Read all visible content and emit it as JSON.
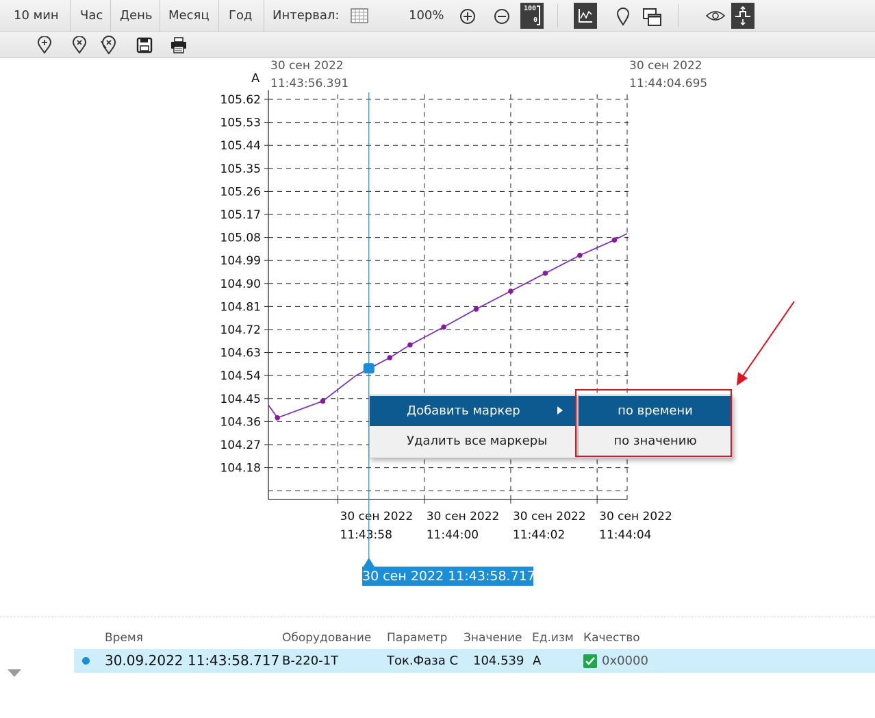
{
  "toolbar": {
    "ranges": [
      "10 мин",
      "Час",
      "День",
      "Месяц",
      "Год"
    ],
    "interval_label": "Интервал:",
    "zoom": "100%",
    "scale_icon_top": "100",
    "scale_icon_bottom": "0"
  },
  "chart_data": {
    "type": "line",
    "unit_label": "A",
    "top_left_date": "30 сен 2022",
    "top_left_time": "11:43:56.391",
    "top_right_date": "30 сен 2022",
    "top_right_time": "11:44:04.695",
    "y_ticks": [
      "105.62",
      "105.53",
      "105.44",
      "105.35",
      "105.26",
      "105.17",
      "105.08",
      "104.99",
      "104.90",
      "104.81",
      "104.72",
      "104.63",
      "104.54",
      "104.45",
      "104.36",
      "104.27",
      "104.18"
    ],
    "x_tick_dates": [
      "30 сен 2022",
      "30 сен 2022",
      "30 сен 2022",
      "30 сен 2022"
    ],
    "x_tick_times": [
      "11:43:58",
      "11:44:00",
      "11:44:02",
      "11:44:04"
    ],
    "ylim": [
      104.09,
      105.64
    ],
    "x_seconds_start": 56.391,
    "x_seconds_end": 64.695,
    "series": [
      {
        "x": [
          56.391,
          56.6,
          57.65,
          58.417,
          59.2,
          59.67,
          60.45,
          61.2,
          62.0,
          62.8,
          63.6,
          64.4,
          64.695
        ],
        "values": [
          104.425,
          104.375,
          104.44,
          104.54,
          104.61,
          104.66,
          104.73,
          104.8,
          104.87,
          104.94,
          105.01,
          105.07,
          105.095
        ],
        "marked": [
          false,
          true,
          true,
          false,
          true,
          true,
          true,
          true,
          true,
          true,
          true,
          true,
          false
        ],
        "color": "#7b35b5",
        "marker_color": "#8a1a9c"
      }
    ],
    "cursor_x": 58.717,
    "cursor_label": "30 сен 2022 11:43:58.717"
  },
  "context_menu": {
    "add_marker": "Добавить маркер",
    "remove_all_markers": "Удалить все маркеры",
    "submenu_by_time": "по времени",
    "submenu_by_value": "по значению"
  },
  "table": {
    "headers": [
      "Время",
      "Оборудование",
      "Параметр",
      "Значение",
      "Ед.изм",
      "Качество"
    ],
    "row": {
      "time": "30.09.2022 11:43:58.717",
      "equipment": "В-220-1Т",
      "parameter": "Ток.Фаза С",
      "value": "104.539",
      "unit": "А",
      "quality": "0x0000"
    }
  },
  "colors": {
    "accent": "#1a8fd8",
    "menu_highlight": "#0d5a91",
    "annotation_red": "#e0141e",
    "row_highlight": "#cdeefa"
  }
}
